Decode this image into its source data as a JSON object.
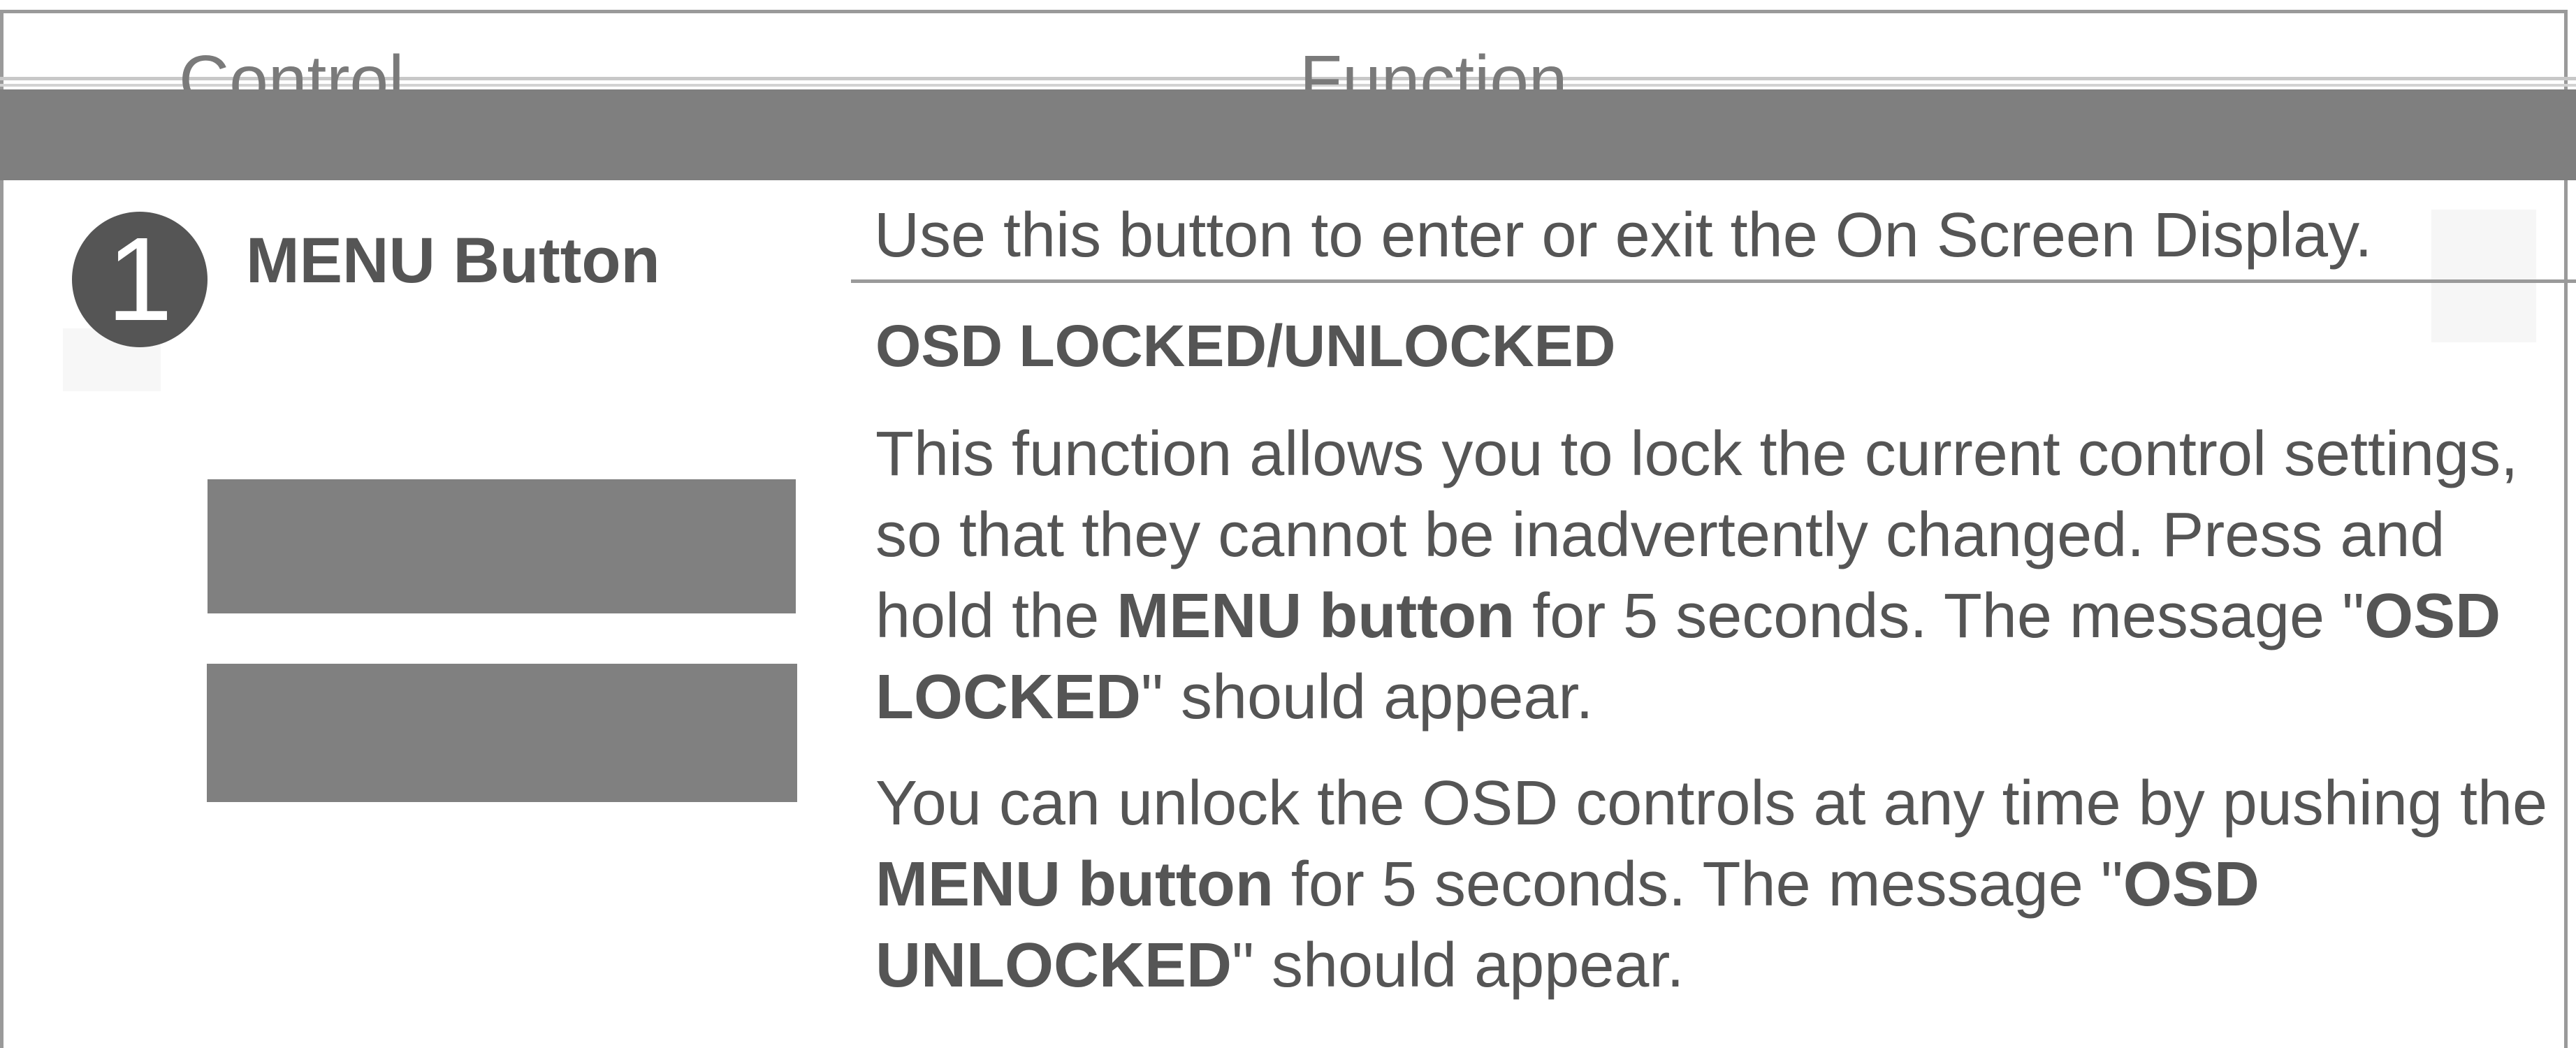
{
  "header": {
    "control_label": "Control",
    "function_label": "Function"
  },
  "row": {
    "callout_number": "1",
    "control_name": "MENU Button",
    "intro": "Use this button to enter or exit the On Screen Display.",
    "section_title": "OSD LOCKED/UNLOCKED",
    "para1": {
      "t1": "This function allows you to lock the current control settings, so that they cannot be inadvertently changed. Press and hold the ",
      "b1": "MENU button",
      "t2": " for 5 seconds. The message \"",
      "b2": "OSD LOCKED",
      "t3": "\" should appear."
    },
    "para2": {
      "t1": "You can unlock the OSD controls at any time by pushing the ",
      "b1": "MENU button",
      "t2": " for 5 seconds. The message \"",
      "b2": "OSD UNLOCKED",
      "t3": "\" should appear."
    }
  },
  "colors": {
    "header_band": "#7f7f7f",
    "text": "#555555",
    "badge": "#555555"
  }
}
